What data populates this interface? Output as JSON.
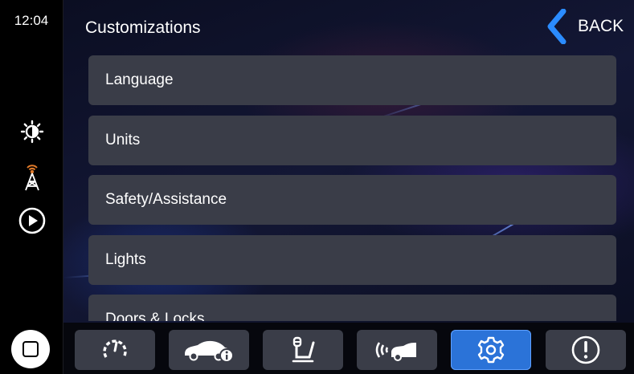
{
  "sidebar": {
    "time": "12:04"
  },
  "header": {
    "title": "Customizations",
    "back_label": "BACK"
  },
  "menu": {
    "items": [
      {
        "label": "Language"
      },
      {
        "label": "Units"
      },
      {
        "label": "Safety/Assistance"
      },
      {
        "label": "Lights"
      },
      {
        "label": "Doors & Locks"
      }
    ]
  },
  "bottom_tabs": [
    {
      "icon": "gauge-icon",
      "active": false
    },
    {
      "icon": "car-info-icon",
      "active": false
    },
    {
      "icon": "seat-icon",
      "active": false
    },
    {
      "icon": "car-sensor-icon",
      "active": false
    },
    {
      "icon": "gear-icon",
      "active": true
    },
    {
      "icon": "alert-icon",
      "active": false
    }
  ],
  "colors": {
    "accent": "#2b73d8",
    "row_bg": "#3a3d48",
    "back_chevron": "#2b8cff"
  }
}
